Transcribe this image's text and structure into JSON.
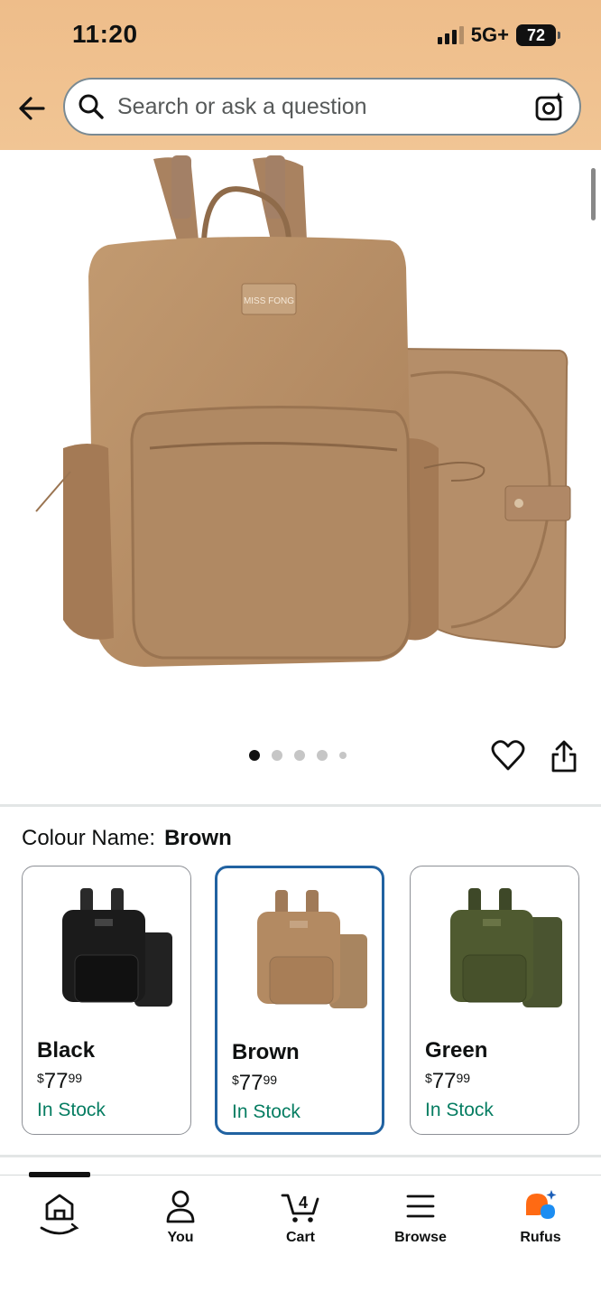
{
  "status_bar": {
    "time": "11:20",
    "network": "5G+",
    "battery": "72"
  },
  "search": {
    "placeholder": "Search or ask a question"
  },
  "product": {
    "image_logo_text": "MISS FONG",
    "carousel": {
      "total": 5,
      "active": 1
    }
  },
  "colour": {
    "label": "Colour Name:",
    "selected": "Brown",
    "options": [
      {
        "name": "Black",
        "currency": "$",
        "price_whole": "77",
        "price_fraction": "99",
        "stock": "In Stock",
        "color": "#1b1b1b"
      },
      {
        "name": "Brown",
        "currency": "$",
        "price_whole": "77",
        "price_fraction": "99",
        "stock": "In Stock",
        "color": "#b38a62"
      },
      {
        "name": "Green",
        "currency": "$",
        "price_whole": "77",
        "price_fraction": "99",
        "stock": "In Stock",
        "color": "#4f5a30"
      }
    ]
  },
  "bottom_nav": {
    "items": [
      {
        "label": "",
        "icon": "home-icon"
      },
      {
        "label": "You",
        "icon": "person-icon"
      },
      {
        "label": "Cart",
        "icon": "cart-icon",
        "badge": "4"
      },
      {
        "label": "Browse",
        "icon": "menu-icon"
      },
      {
        "label": "Rufus",
        "icon": "rufus-icon"
      }
    ]
  },
  "colors": {
    "header": "#eebd8a",
    "accent_blue": "#2162a1",
    "in_stock": "#067d62"
  }
}
